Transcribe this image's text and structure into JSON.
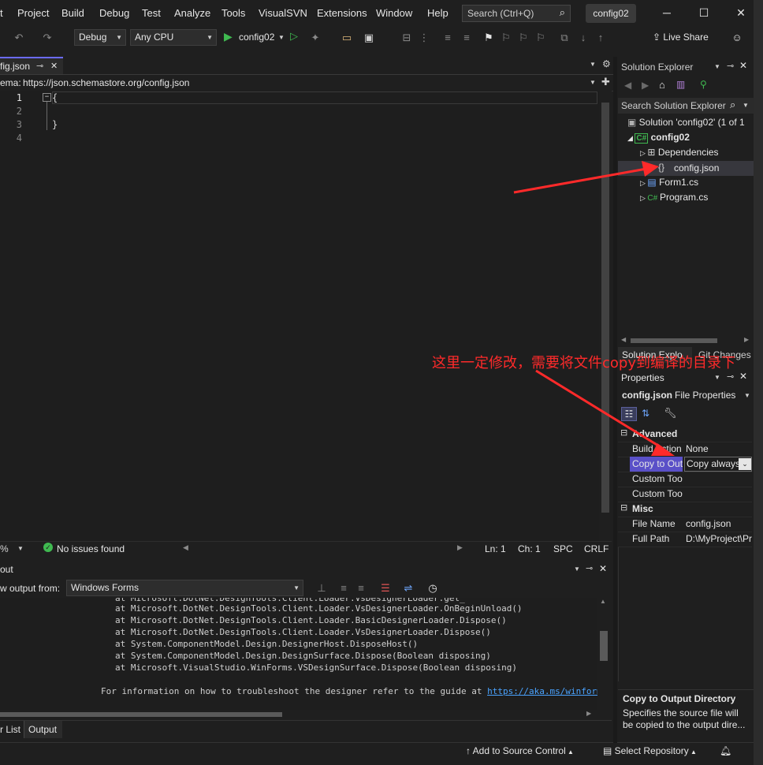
{
  "menu": [
    "Project",
    "Build",
    "Debug",
    "Test",
    "Analyze",
    "Tools",
    "VisualSVN",
    "Extensions",
    "Window",
    "Help"
  ],
  "search": {
    "label": "Search (Ctrl+Q)"
  },
  "project_badge": "config02",
  "toolbar": {
    "config": "Debug",
    "platform": "Any CPU",
    "start_target": "config02",
    "live_share": "Live Share"
  },
  "editor": {
    "tab_label": "fig.json",
    "schema_prefix": "ema:",
    "schema_url": "https://json.schemastore.org/config.json",
    "lines": [
      {
        "num": "1",
        "text": "{"
      },
      {
        "num": "2",
        "text": ""
      },
      {
        "num": "3",
        "text": "}"
      },
      {
        "num": "4",
        "text": ""
      }
    ],
    "zoom": "%",
    "issues": "No issues found",
    "ln": "Ln: 1",
    "ch": "Ch: 1",
    "spc": "SPC",
    "crlf": "CRLF"
  },
  "output": {
    "title": "out",
    "show_from_label": "w output from:",
    "source": "Windows Forms",
    "lines": [
      "at Microsoft.DotNet.DesignTools.Client.Loader.VsDesignerLoader.OnBeginUnload()",
      "at Microsoft.DotNet.DesignTools.Client.Loader.BasicDesignerLoader.Dispose()",
      "at Microsoft.DotNet.DesignTools.Client.Loader.VsDesignerLoader.Dispose()",
      "at System.ComponentModel.Design.DesignerHost.DisposeHost()",
      "at System.ComponentModel.Design.DesignSurface.Dispose(Boolean disposing)",
      "at Microsoft.VisualStudio.WinForms.VSDesignSurface.Dispose(Boolean disposing)"
    ],
    "info_prefix": "For information on how to troubleshoot the designer refer to the guide at ",
    "info_link": "https://aka.ms/winforms/designe"
  },
  "bottom_tabs": [
    "r List",
    "Output"
  ],
  "status": {
    "source_control": "Add to Source Control",
    "repository": "Select Repository"
  },
  "solution_explorer": {
    "title": "Solution Explorer",
    "search": "Search Solution Explorer",
    "solution": "Solution 'config02' (1 of 1",
    "project": "config02",
    "items": [
      "Dependencies",
      "config.json",
      "Form1.cs",
      "Program.cs"
    ],
    "tabs": [
      "Solution Explo",
      "Git Changes"
    ]
  },
  "properties": {
    "title": "Properties",
    "object": "config.json",
    "object_type": "File Properties",
    "sections": [
      {
        "name": "Advanced",
        "rows": [
          {
            "key": "Build Action",
            "val": "None"
          },
          {
            "key": "Copy to Output Directory",
            "val": "Copy always"
          },
          {
            "key": "Custom Tool",
            "val": ""
          },
          {
            "key": "Custom Tool Namespace",
            "val": ""
          }
        ]
      },
      {
        "name": "Misc",
        "rows": [
          {
            "key": "File Name",
            "val": "config.json"
          },
          {
            "key": "Full Path",
            "val": "D:\\MyProject\\Pr"
          }
        ]
      }
    ],
    "desc_title": "Copy to Output Directory",
    "desc_text": "Specifies the source file will be copied to the output dire..."
  },
  "annotation": {
    "text": "这里一定修改，需要将文件copy到编译的目录下",
    "color": "#ff2a2a"
  }
}
